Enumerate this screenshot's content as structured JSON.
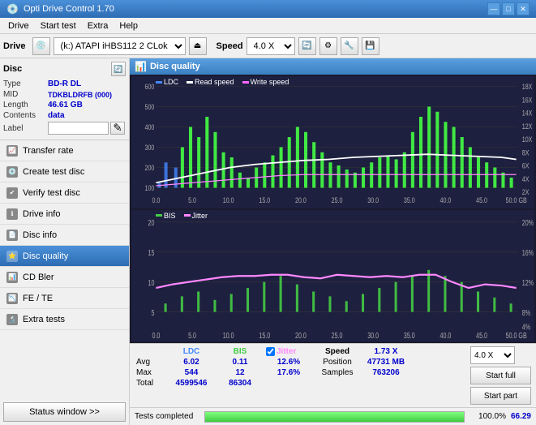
{
  "titlebar": {
    "title": "Opti Drive Control 1.70",
    "icon": "💿",
    "buttons": [
      "—",
      "□",
      "✕"
    ]
  },
  "menubar": {
    "items": [
      "Drive",
      "Start test",
      "Extra",
      "Help"
    ]
  },
  "toolbar": {
    "drive_label": "Drive",
    "drive_value": "(k:) ATAPI iHBS112  2 CLok",
    "speed_label": "Speed",
    "speed_value": "4.0 X"
  },
  "disc": {
    "title": "Disc",
    "type_label": "Type",
    "type_value": "BD-R DL",
    "mid_label": "MID",
    "mid_value": "TDKBLDRFB (000)",
    "length_label": "Length",
    "length_value": "46.61 GB",
    "contents_label": "Contents",
    "contents_value": "data",
    "label_label": "Label",
    "label_value": ""
  },
  "nav": {
    "items": [
      {
        "id": "transfer-rate",
        "label": "Transfer rate",
        "icon": "📈"
      },
      {
        "id": "create-test-disc",
        "label": "Create test disc",
        "icon": "💿"
      },
      {
        "id": "verify-test-disc",
        "label": "Verify test disc",
        "icon": "✔"
      },
      {
        "id": "drive-info",
        "label": "Drive info",
        "icon": "ℹ"
      },
      {
        "id": "disc-info",
        "label": "Disc info",
        "icon": "📄"
      },
      {
        "id": "disc-quality",
        "label": "Disc quality",
        "icon": "⭐",
        "active": true
      },
      {
        "id": "cd-bler",
        "label": "CD Bler",
        "icon": "📊"
      },
      {
        "id": "fe-te",
        "label": "FE / TE",
        "icon": "📉"
      },
      {
        "id": "extra-tests",
        "label": "Extra tests",
        "icon": "🔬"
      }
    ]
  },
  "status_window_btn": "Status window >>",
  "disc_quality": {
    "header": "Disc quality",
    "chart1": {
      "legend": [
        {
          "label": "LDC",
          "color": "#4488ff"
        },
        {
          "label": "Read speed",
          "color": "white"
        },
        {
          "label": "Write speed",
          "color": "#ff66ff"
        }
      ],
      "y_max": 600,
      "y_labels": [
        "600",
        "500",
        "400",
        "300",
        "200",
        "100",
        "0"
      ],
      "y_right": [
        "18X",
        "16X",
        "14X",
        "12X",
        "10X",
        "8X",
        "6X",
        "4X",
        "2X"
      ],
      "x_labels": [
        "0.0",
        "5.0",
        "10.0",
        "15.0",
        "20.0",
        "25.0",
        "30.0",
        "35.0",
        "40.0",
        "45.0",
        "50.0 GB"
      ]
    },
    "chart2": {
      "legend": [
        {
          "label": "BIS",
          "color": "#44cc44"
        },
        {
          "label": "Jitter",
          "color": "#ff88ff"
        }
      ],
      "y_max": 20,
      "y_labels": [
        "20",
        "15",
        "10",
        "5",
        "0"
      ],
      "y_right": [
        "20%",
        "16%",
        "12%",
        "8%",
        "4%"
      ],
      "x_labels": [
        "0.0",
        "5.0",
        "10.0",
        "15.0",
        "20.0",
        "25.0",
        "30.0",
        "35.0",
        "40.0",
        "45.0",
        "50.0 GB"
      ]
    }
  },
  "stats": {
    "columns": [
      "",
      "LDC",
      "BIS",
      "",
      "Jitter",
      "Speed",
      "",
      ""
    ],
    "rows": [
      {
        "label": "Avg",
        "ldc": "6.02",
        "bis": "0.11",
        "jitter": "12.6%",
        "speed_label": "Position",
        "speed_val": "47731 MB"
      },
      {
        "label": "Max",
        "ldc": "544",
        "bis": "12",
        "jitter": "17.6%",
        "speed_label": "Samples",
        "speed_val": "763206"
      },
      {
        "label": "Total",
        "ldc": "4599546",
        "bis": "86304",
        "jitter": "",
        "speed_label": "",
        "speed_val": ""
      }
    ],
    "speed_display": "1.73 X",
    "speed_select": "4.0 X",
    "jitter_checked": true,
    "btn_start_full": "Start full",
    "btn_start_part": "Start part"
  },
  "statusbar": {
    "text": "Tests completed",
    "progress": 100,
    "percentage": "100.0%",
    "extra": "66.29"
  }
}
